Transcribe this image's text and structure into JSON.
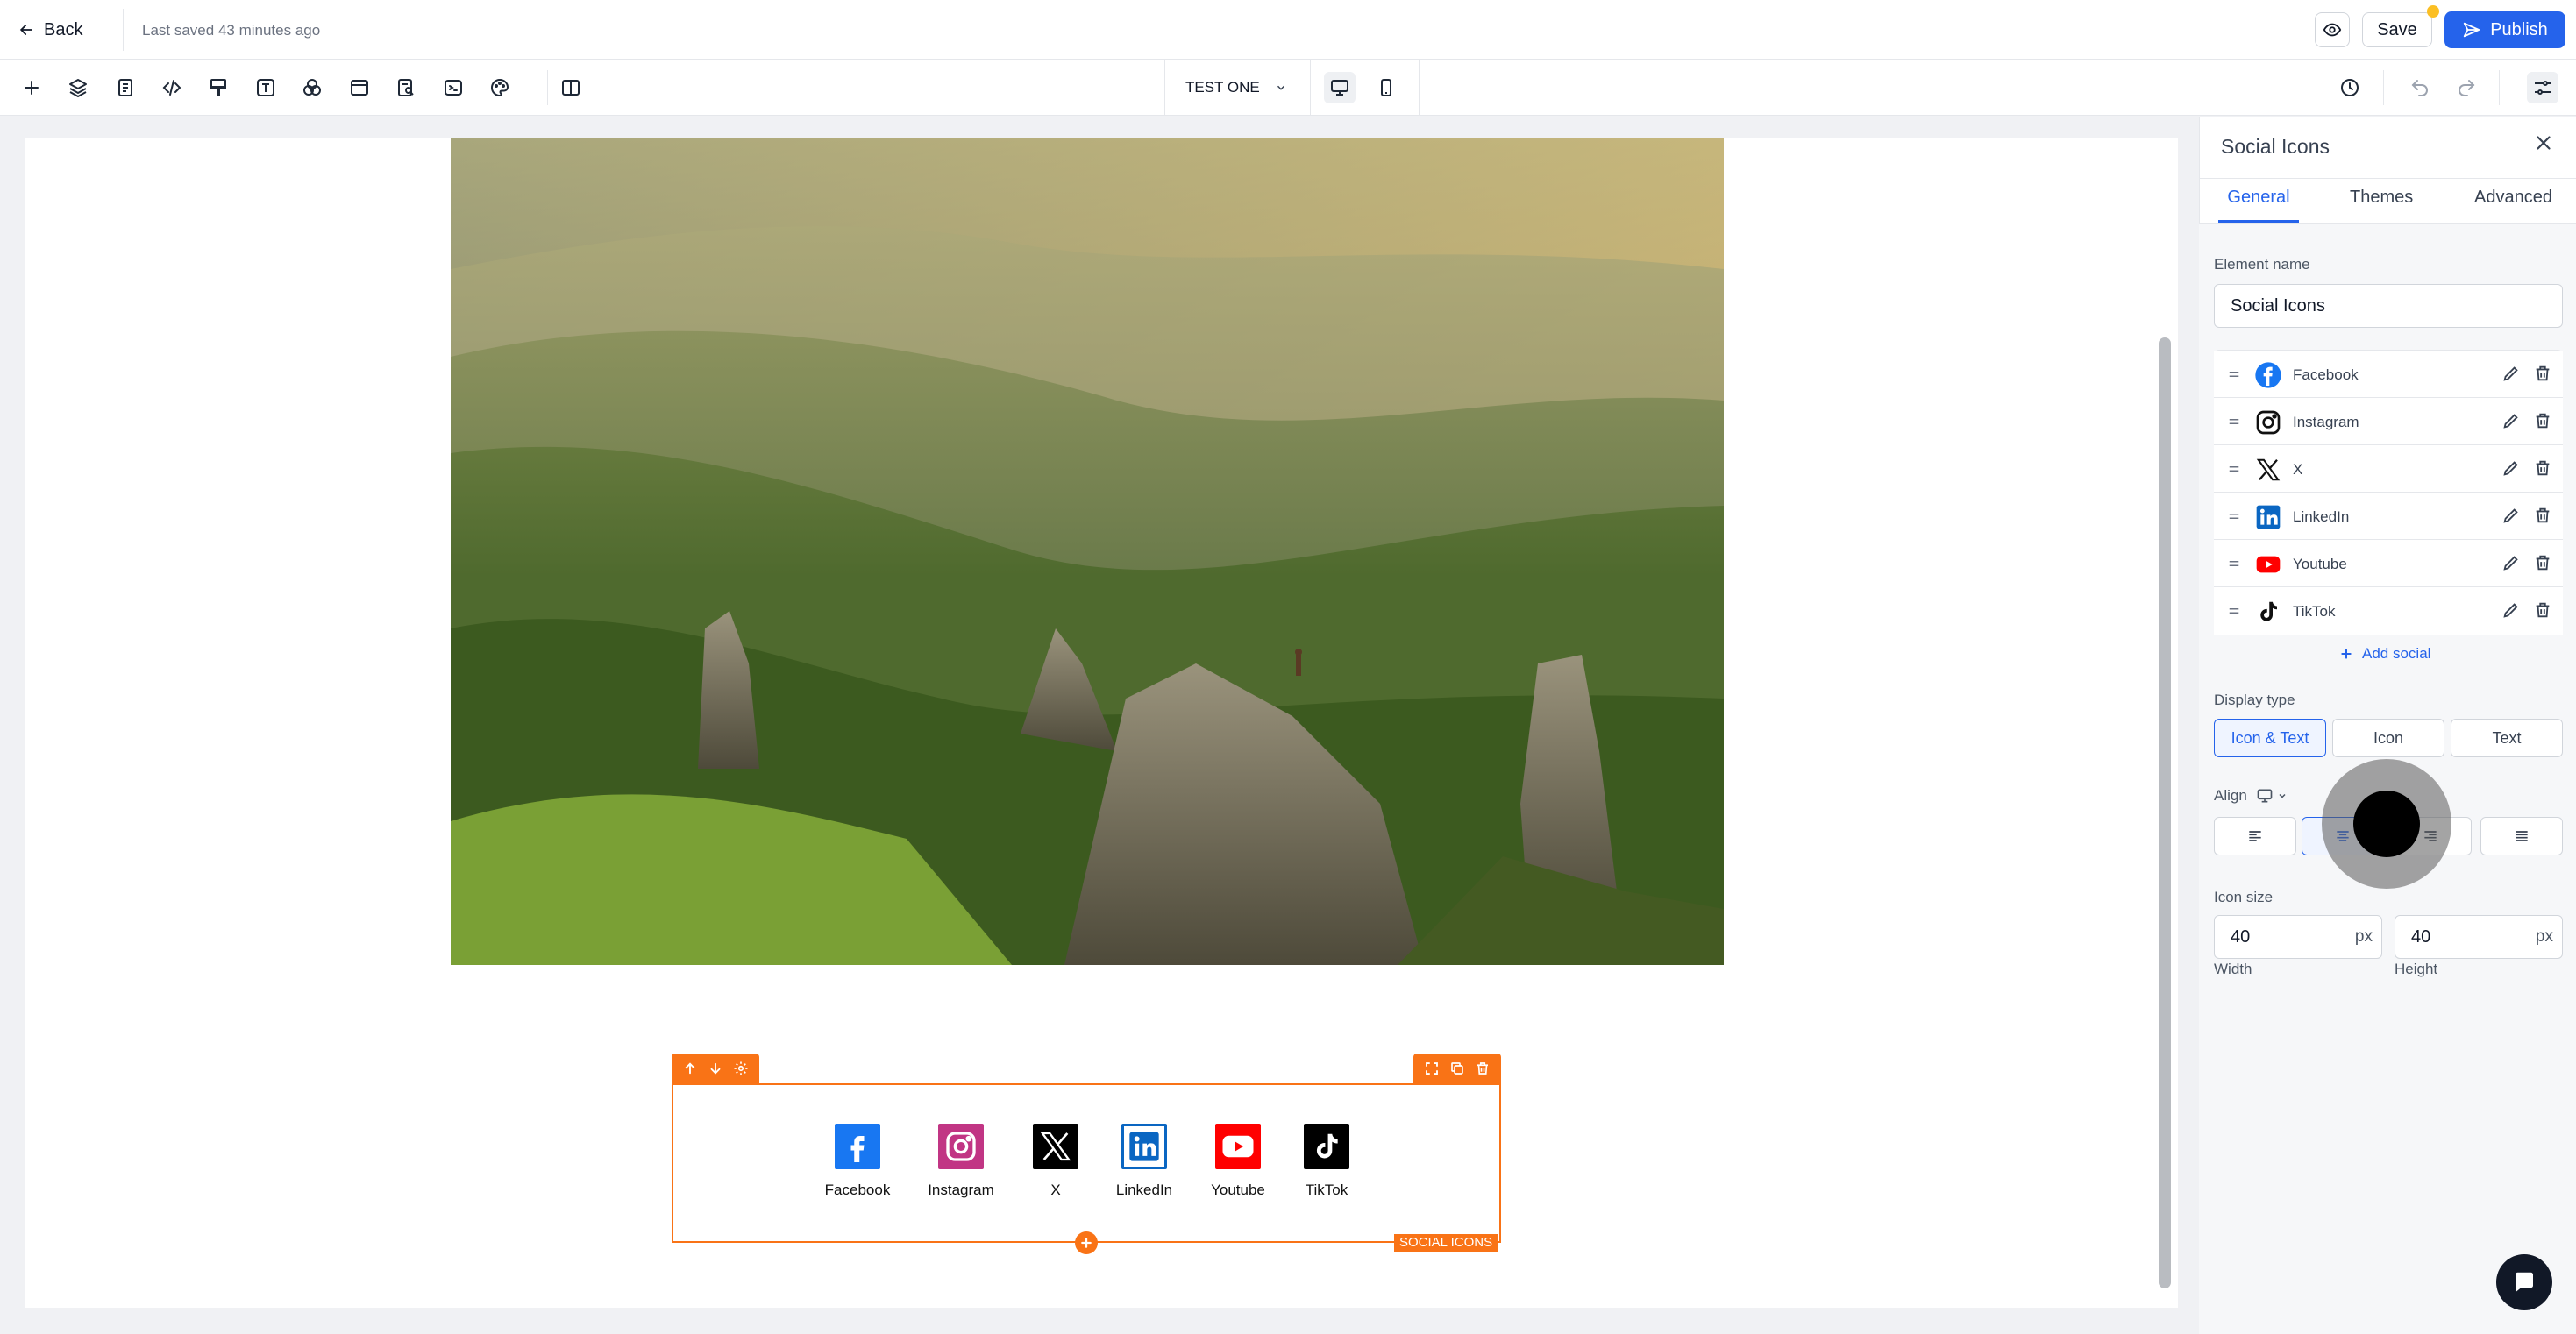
{
  "header": {
    "back_label": "Back",
    "saved_status": "Last saved 43 minutes ago",
    "save_label": "Save",
    "publish_label": "Publish"
  },
  "toolbar": {
    "page_selector": "TEST ONE",
    "tools": [
      "add-icon",
      "layers-icon",
      "pages-icon",
      "code-icon",
      "paint-icon",
      "text-icon",
      "shapes-icon",
      "layout-icon",
      "seo-icon",
      "terminal-icon",
      "palette-icon",
      "split-view-icon"
    ]
  },
  "canvas": {
    "social_items": [
      {
        "label": "Facebook",
        "icon": "facebook-icon",
        "color": "#1877f2"
      },
      {
        "label": "Instagram",
        "icon": "instagram-icon",
        "color": "#c13584"
      },
      {
        "label": "X",
        "icon": "x-icon",
        "color": "#000000"
      },
      {
        "label": "LinkedIn",
        "icon": "linkedin-icon",
        "color": "#0a66c2"
      },
      {
        "label": "Youtube",
        "icon": "youtube-icon",
        "color": "#ff0000"
      },
      {
        "label": "TikTok",
        "icon": "tiktok-icon",
        "color": "#000000"
      }
    ],
    "element_tag": "SOCIAL ICONS",
    "selection_color": "#f97316"
  },
  "panel": {
    "title": "Social Icons",
    "tabs": [
      "General",
      "Themes",
      "Advanced"
    ],
    "active_tab": "General",
    "element_name_label": "Element name",
    "element_name_value": "Social Icons",
    "socials": [
      "Facebook",
      "Instagram",
      "X",
      "LinkedIn",
      "Youtube",
      "TikTok"
    ],
    "add_social_label": "Add social",
    "display_type_label": "Display type",
    "display_types": [
      "Icon & Text",
      "Icon",
      "Text"
    ],
    "display_type_selected": "Icon & Text",
    "align_label": "Align",
    "icon_size_label": "Icon size",
    "width_value": "40",
    "height_value": "40",
    "unit": "px",
    "width_label": "Width",
    "height_label": "Height",
    "accent": "#2563eb"
  }
}
